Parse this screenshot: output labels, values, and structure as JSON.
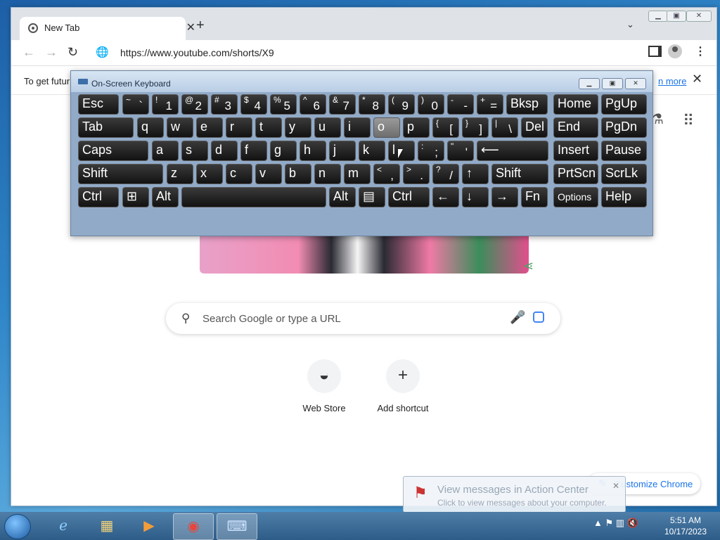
{
  "browser": {
    "tab_title": "New Tab",
    "tab_close": "✕",
    "new_tab": "+",
    "url": "https://www.youtube.com/shorts/X9",
    "infobar_message": "To get futur",
    "infobar_link": "n more",
    "infobar_close": "✕"
  },
  "newtab": {
    "search_placeholder": "Search Google or type a URL",
    "shortcuts": [
      {
        "label": "Web Store",
        "icon": "web-store-icon"
      },
      {
        "label": "Add shortcut",
        "icon": "plus-icon",
        "glyph": "+"
      }
    ],
    "customize_label": "Customize Chrome"
  },
  "keyboard": {
    "title": "On-Screen Keyboard",
    "rows": [
      [
        {
          "m": "Esc"
        },
        {
          "sh": "~",
          "lo": "`"
        },
        {
          "sh": "!",
          "lo": "1"
        },
        {
          "sh": "@",
          "lo": "2"
        },
        {
          "sh": "#",
          "lo": "3"
        },
        {
          "sh": "$",
          "lo": "4"
        },
        {
          "sh": "%",
          "lo": "5"
        },
        {
          "sh": "^",
          "lo": "6"
        },
        {
          "sh": "&",
          "lo": "7"
        },
        {
          "sh": "*",
          "lo": "8"
        },
        {
          "sh": "(",
          "lo": "9"
        },
        {
          "sh": ")",
          "lo": "0"
        },
        {
          "sh": "-",
          "lo": "-"
        },
        {
          "sh": "+",
          "lo": "="
        },
        {
          "m": "Bksp"
        },
        {
          "m": "Home"
        },
        {
          "m": "PgUp"
        }
      ],
      [
        {
          "m": "Tab"
        },
        {
          "m": "q"
        },
        {
          "m": "w"
        },
        {
          "m": "e"
        },
        {
          "m": "r"
        },
        {
          "m": "t"
        },
        {
          "m": "y"
        },
        {
          "m": "u"
        },
        {
          "m": "i"
        },
        {
          "m": "o",
          "hl": true
        },
        {
          "m": "p"
        },
        {
          "sh": "{",
          "lo": "["
        },
        {
          "sh": "}",
          "lo": "]"
        },
        {
          "sh": "|",
          "lo": "\\"
        },
        {
          "m": "Del"
        },
        {
          "m": "End"
        },
        {
          "m": "PgDn"
        }
      ],
      [
        {
          "m": "Caps"
        },
        {
          "m": "a"
        },
        {
          "m": "s"
        },
        {
          "m": "d"
        },
        {
          "m": "f"
        },
        {
          "m": "g"
        },
        {
          "m": "h"
        },
        {
          "m": "j"
        },
        {
          "m": "k"
        },
        {
          "m": "l"
        },
        {
          "sh": ":",
          "lo": ";"
        },
        {
          "sh": "\"",
          "lo": "'"
        },
        {
          "m": "⟵"
        },
        {
          "m": "Insert"
        },
        {
          "m": "Pause"
        }
      ],
      [
        {
          "m": "Shift"
        },
        {
          "m": "z"
        },
        {
          "m": "x"
        },
        {
          "m": "c"
        },
        {
          "m": "v"
        },
        {
          "m": "b"
        },
        {
          "m": "n"
        },
        {
          "m": "m"
        },
        {
          "sh": "<",
          "lo": ","
        },
        {
          "sh": ">",
          "lo": "."
        },
        {
          "sh": "?",
          "lo": "/"
        },
        {
          "m": "↑"
        },
        {
          "m": "Shift"
        },
        {
          "m": "PrtScn"
        },
        {
          "m": "ScrLk"
        }
      ],
      [
        {
          "m": "Ctrl"
        },
        {
          "m": "⊞"
        },
        {
          "m": "Alt"
        },
        {
          "m": ""
        },
        {
          "m": "Alt"
        },
        {
          "m": "▤"
        },
        {
          "m": "Ctrl"
        },
        {
          "m": "←"
        },
        {
          "m": "↓"
        },
        {
          "m": "→"
        },
        {
          "m": "Fn"
        },
        {
          "m": "Options",
          "small": true
        },
        {
          "m": "Help"
        }
      ]
    ]
  },
  "notification": {
    "title": "View messages in Action Center",
    "subtitle": "Click to view messages about your computer.",
    "close": "✕"
  },
  "taskbar": {
    "time": "5:51 AM",
    "date": "10/17/2023",
    "apps": [
      "internet-explorer-icon",
      "file-explorer-icon",
      "media-player-icon",
      "chrome-icon",
      "on-screen-keyboard-icon"
    ]
  }
}
